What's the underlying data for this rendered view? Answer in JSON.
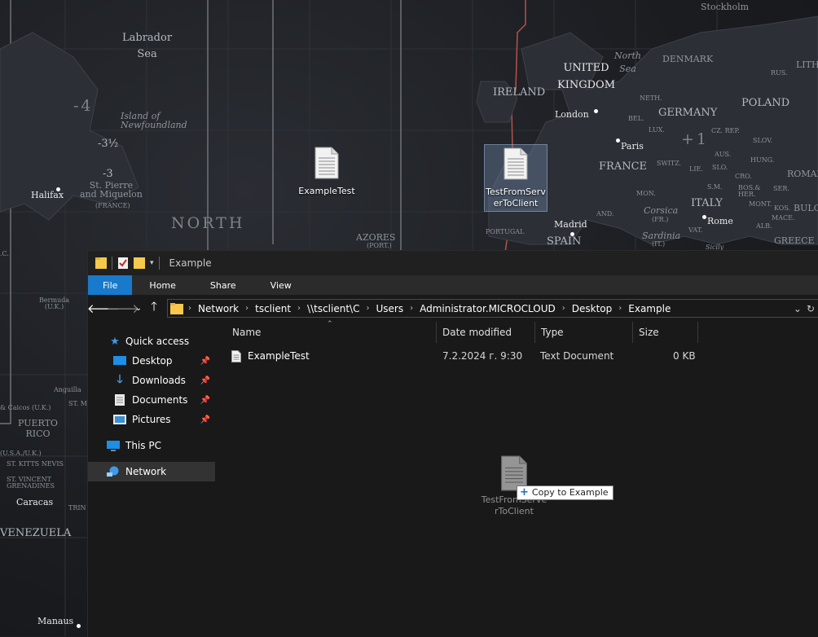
{
  "desktop": {
    "map_labels": {
      "stockholm": "Stockholm",
      "labrador_sea": "Labrador\nSea",
      "tz_minus4": "-4",
      "island_of_newfoundland": "Island of\nNewfoundland",
      "tz_minus3_5": "-3½",
      "tz_minus3": "-3",
      "st_pierre": "St. Pierre\nand Miquelon",
      "france_paren": "(FRANCE)",
      "halifax": "Halifax",
      "north": "NORTH",
      "azores": "AZORES",
      "port": "(PORT.)",
      "united_kingdom": "UNITED\nKINGDOM",
      "north_sea": "North\nSea",
      "denmark": "DENMARK",
      "lith": "LITH.",
      "rus": "RUS.",
      "ireland": "IRELAND",
      "london": "London",
      "neth": "NETH.",
      "germany": "GERMANY",
      "poland": "POLAND",
      "bel": "BEL.",
      "lux": "LUX.",
      "paris": "Paris",
      "tz_plus1": "+1",
      "cz_rep": "CZ. REP.",
      "slov": "SLOV.",
      "aus": "AUS.",
      "hung": "HUNG.",
      "france": "FRANCE",
      "switz": "SWITZ.",
      "lie": "LIE.",
      "slo": "SLO.",
      "cro": "CRO.",
      "roman": "ROMAN",
      "mon": "MON.",
      "s_m": "S.M.",
      "bos_her": "BOS.&\nHER.",
      "ser": "SER.",
      "corsica": "Corsica",
      "fr": "(FR.)",
      "italy": "ITALY",
      "mont": "MONT.",
      "kos": "KOS.",
      "mace": "MACE.",
      "bulg": "BULG",
      "madrid": "Madrid",
      "and": "AND.",
      "rome": "Rome",
      "portugal": "PORTUGAL",
      "spain": "SPAIN",
      "sardinia": "Sardinia",
      "it": "(IT.)",
      "vat": "VAT.",
      "alb": "ALB.",
      "greece": "GREECE",
      "sicily": "Sicily",
      "bermuda": "Bermuda\n(U.K.)",
      "anguilla": "Anguilla",
      "turks": "& Caicos (U.K.)",
      "puerto_rico": "PUERTO\nRICO",
      "usa_uk": "(U.S.A./U.K.)",
      "st_kitts": "ST. KITTS NEVIS",
      "st_vincent": "ST. VINCENT\nGRENADINES",
      "caracas": "Caracas",
      "venezuela": "VENEZUELA",
      "manaus": "Manaus",
      "lc": ".C.",
      "st_m": "ST. M",
      "trin": "TRIN"
    },
    "icons": [
      {
        "label": "ExampleTest"
      },
      {
        "label": "TestFromServerToClient"
      }
    ]
  },
  "explorer": {
    "title": "Example",
    "ribbon_tabs": [
      "File",
      "Home",
      "Share",
      "View"
    ],
    "address": {
      "crumbs": [
        "Network",
        "tsclient",
        "\\\\tsclient\\C",
        "Users",
        "Administrator.MICROCLOUD",
        "Desktop",
        "Example"
      ],
      "separator": "›",
      "dropdown_icon": "chevron-down-icon",
      "refresh_icon": "refresh-icon"
    },
    "nav": {
      "back_icon": "arrow-left-icon",
      "forward_icon": "arrow-right-icon",
      "recent_icon": "chevron-down-icon",
      "up_icon": "arrow-up-icon"
    },
    "navpane": {
      "quick_access": "Quick access",
      "desktop": "Desktop",
      "downloads": "Downloads",
      "documents": "Documents",
      "pictures": "Pictures",
      "this_pc": "This PC",
      "network": "Network"
    },
    "columns": {
      "name": "Name",
      "date_modified": "Date modified",
      "type": "Type",
      "size": "Size"
    },
    "files": [
      {
        "name": "ExampleTest",
        "date_modified": "7.2.2024 г. 9:30",
        "type": "Text Document",
        "size": "0 KB"
      }
    ],
    "drag": {
      "ghost_label": "TestFromServerToClient",
      "tooltip": "Copy to Example",
      "tooltip_icon": "plus-icon"
    }
  },
  "colors": {
    "file_tab": "#1979ca",
    "explorer_bg": "#191919",
    "selected_nav": "#333333"
  }
}
